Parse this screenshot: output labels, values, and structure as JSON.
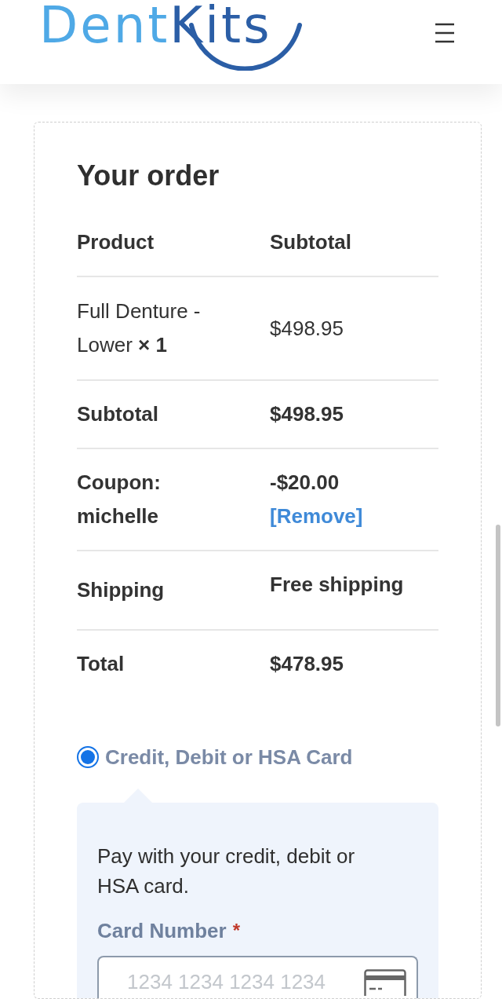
{
  "header": {
    "logo": {
      "parts": [
        "Dent",
        "Kits"
      ]
    }
  },
  "order": {
    "title": "Your order",
    "columns": [
      "Product",
      "Subtotal"
    ],
    "items": [
      {
        "name": "Full Denture - Lower **× 1**",
        "subtotal": "$498.95"
      }
    ],
    "totals": [
      {
        "kind": "amount",
        "label": "Subtotal",
        "value": "$498.95"
      },
      {
        "kind": "coupon",
        "label": "Coupon: michelle",
        "value": "-$20.00",
        "action": "[Remove]"
      },
      {
        "kind": "shipping",
        "label": "Shipping",
        "value": "Free shipping"
      },
      {
        "kind": "total",
        "label": "Total",
        "value": "$478.95"
      }
    ]
  },
  "payment": {
    "methods": [
      {
        "label": "Credit, Debit or HSA Card",
        "selected": true
      }
    ],
    "description": "Pay with your credit, debit or HSA card.",
    "card_number": {
      "label": "Card Number",
      "required_mark": "*",
      "placeholder": "1234 1234 1234 1234"
    }
  }
}
